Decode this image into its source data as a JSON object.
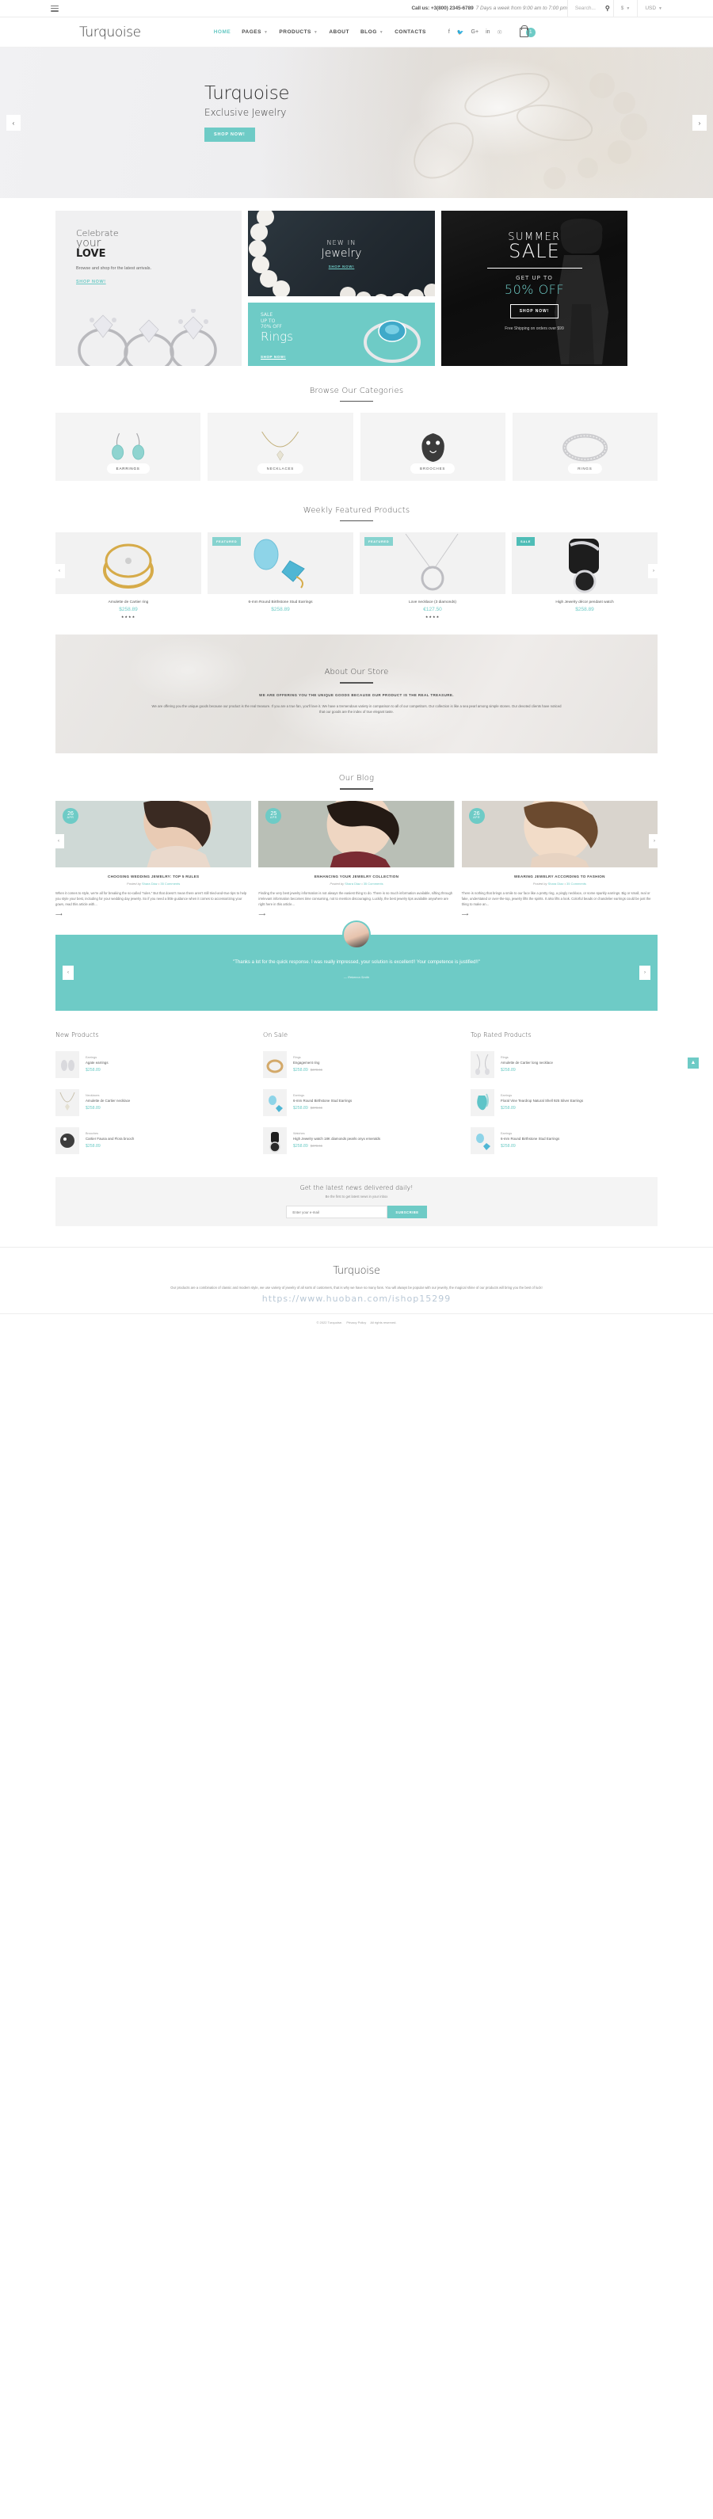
{
  "topbar": {
    "menu_icon": "hamburger-icon",
    "call_label": "Call us: +3(800) 2345-6789",
    "hours": "7 Days a week from 9:00 am to 7:00 pm",
    "search_placeholder": "Search...",
    "search_icon": "search-icon",
    "currency_symbol": "$",
    "currency_code": "USD"
  },
  "nav": {
    "logo": "Turquoise",
    "items": [
      {
        "label": "HOME",
        "active": true,
        "caret": false
      },
      {
        "label": "PAGES",
        "active": false,
        "caret": true
      },
      {
        "label": "PRODUCTS",
        "active": false,
        "caret": true
      },
      {
        "label": "ABOUT",
        "active": false,
        "caret": false
      },
      {
        "label": "BLOG",
        "active": false,
        "caret": true
      },
      {
        "label": "CONTACTS",
        "active": false,
        "caret": false
      }
    ],
    "socials": [
      "facebook-icon",
      "twitter-icon",
      "google-plus-icon",
      "linkedin-icon",
      "pinterest-icon"
    ],
    "cart_count": "1",
    "cart_icon": "shopping-bag-icon"
  },
  "hero": {
    "title": "Turquoise",
    "subtitle": "Exclusive Jewelry",
    "button": "SHOP NOW!",
    "prev_icon": "chevron-left-icon",
    "next_icon": "chevron-right-icon"
  },
  "promos": {
    "love": {
      "line1": "Celebrate",
      "line2": "your",
      "line3": "LOVE",
      "sub": "Browse and shop for the latest arrivals.",
      "link": "SHOP NOW!"
    },
    "new_in": {
      "line1": "NEW IN",
      "line2": "Jewelry",
      "link": "SHOP NOW!"
    },
    "rings": {
      "small": "SALE\nUP TO\n70% OFF",
      "small_l1": "SALE",
      "small_l2": "UP TO",
      "small_l3": "70% OFF",
      "big": "Rings",
      "link": "SHOP NOW!"
    },
    "summer": {
      "line1": "SUMMER",
      "line2": "SALE",
      "get": "GET UP TO",
      "off": "50% OFF",
      "button": "SHOP NOW!",
      "shipping": "Free Shipping on orders over $99"
    }
  },
  "categories": {
    "title": "Browse Our Categories",
    "items": [
      {
        "label": "EARRINGS",
        "active": true
      },
      {
        "label": "NECKLACES",
        "active": false
      },
      {
        "label": "BROOCHES",
        "active": false
      },
      {
        "label": "RINGS",
        "active": false
      }
    ]
  },
  "featured": {
    "title": "Weekly Featured Products",
    "prev_icon": "chevron-left-icon",
    "next_icon": "chevron-right-icon",
    "items": [
      {
        "name": "Amulette de Cartier ring",
        "price": "$258.89",
        "tag": "",
        "stars": "★★★★"
      },
      {
        "name": "6-mm Round Birthstone Stud Earrings",
        "price": "$258.89",
        "tag": "FEATURED",
        "stars": ""
      },
      {
        "name": "Love necklace (3 diamonds)",
        "price": "€127.50",
        "tag": "FEATURED",
        "stars": "★★★★"
      },
      {
        "name": "High Jewelry décor pendant watch",
        "price": "$258.89",
        "tag": "SALE",
        "stars": ""
      }
    ]
  },
  "about": {
    "title": "About Our Store",
    "lead": "WE ARE OFFERING YOU THE UNIQUE GOODS BECAUSE OUR PRODUCT IS THE REAL TREASURE.",
    "body": "We are offering you the unique goods because our product is the real treasure. If you are a true fan, you'll love it. We have a tremendous variety in comparison to all of our competitors. Our collection is like a sea pearl among simple stones. Our devoted clients have noticed that our goods are the index of true elegant taste."
  },
  "blog": {
    "title": "Our Blog",
    "prev_icon": "chevron-left-icon",
    "next_icon": "chevron-right-icon",
    "posts": [
      {
        "day": "26",
        "month": "APR",
        "title": "CHOOSING WEDDING JEWELRY: TOP 5 RULES",
        "meta_by": "Posted by",
        "meta_author": "Shara Diaz",
        "meta_comments": "35 Comments",
        "excerpt": "When it comes to style, we're all for breaking the so-called \"rules.\" But that doesn't mean there aren't still tried-and-true tips to help you style your best, including for your wedding day jewelry. So if you need a little guidance when it comes to accessorizing your gown, read this article with...",
        "more_icon": "arrow-right-icon"
      },
      {
        "day": "25",
        "month": "APR",
        "title": "ENHANCING YOUR JEWELRY COLLECTION",
        "meta_by": "Posted by",
        "meta_author": "Shara Diaz",
        "meta_comments": "35 Comments",
        "excerpt": "Finding the very best jewelry information is not always the easiest thing to do. There is so much information available, sifting through irrelevant information becomes time consuming, not to mention discouraging. Luckily, the best jewelry tips available anywhere are right here in this article...",
        "more_icon": "arrow-right-icon"
      },
      {
        "day": "26",
        "month": "APR",
        "title": "WEARING JEWELRY ACCORDING TO FASHION",
        "meta_by": "Posted by",
        "meta_author": "Shara Diaz",
        "meta_comments": "35 Comments",
        "excerpt": "There is nothing that brings a smile to our face like a pretty ring, a pingly necklace, or some sparkly earrings. Big or small, real or fake, understated or over-the-top, jewelry lifts the spirits. It also lifts a look. Colorful beads or chandelier earrings could be just the thing to make an...",
        "more_icon": "arrow-right-icon"
      }
    ]
  },
  "testimonial": {
    "quote": "\"Thanks a lot for the quick response. I was really impressed, your solution is excellent!! Your competence is justified!!\"",
    "author": "— Rebecca Smith",
    "prev_icon": "chevron-left-icon",
    "next_icon": "chevron-right-icon",
    "avatar": "avatar-image"
  },
  "product_lists": [
    {
      "heading": "New Products",
      "items": [
        {
          "cat": "Earrings",
          "name": "Agate earrings",
          "price": "$258.89",
          "old": ""
        },
        {
          "cat": "Necklaces",
          "name": "Amulette de Cartier necklace",
          "price": "$258.89",
          "old": ""
        },
        {
          "cat": "Brooches",
          "name": "Cartier Fauna and Flora brooch",
          "price": "$258.89",
          "old": ""
        }
      ]
    },
    {
      "heading": "On Sale",
      "items": [
        {
          "cat": "Rings",
          "name": "Engagement ring",
          "price": "$258.89",
          "old": "$378.66"
        },
        {
          "cat": "Earrings",
          "name": "6-mm Round Birthstone Stud Earrings",
          "price": "$258.89",
          "old": "$378.66"
        },
        {
          "cat": "Watches",
          "name": "High Jewelry watch 18K diamonds pearls onyx emeralds",
          "price": "$258.89",
          "old": "$378.66"
        }
      ]
    },
    {
      "heading": "Top Rated Products",
      "items": [
        {
          "cat": "Rings",
          "name": "Amulette de Cartier long necklace",
          "price": "$258.89",
          "old": ""
        },
        {
          "cat": "Earrings",
          "name": "Floral Vine Teardrop Natural Shell 925 Silver Earrings",
          "price": "$258.89",
          "old": ""
        },
        {
          "cat": "Earrings",
          "name": "6-mm Round Birthstone Stud Earrings",
          "price": "$258.89",
          "old": ""
        }
      ]
    }
  ],
  "newsletter": {
    "title": "Get the latest news delivered daily!",
    "subtitle": "Be the first to get latest news in your inbox",
    "placeholder": "Enter your e-mail",
    "button": "SUBSCRIBE"
  },
  "footer": {
    "logo": "Turquoise",
    "text": "Our products are a combination of classic and modern style, we use variety of jewelry of all sorts of customers, that is why we have so many fans. You will always be popular with our jewelry, the magical shine of our products will bring you the best of luck!",
    "watermark": "https://www.huoban.com/ishop15299",
    "copyright": "© 2022 Turquoise.",
    "links": [
      "Privacy Policy",
      "All rights reserved."
    ],
    "scroll_top_icon": "arrow-up-icon"
  },
  "colors": {
    "accent": "#6ecbc6",
    "dark": "#2e2e2e",
    "muted": "#8a8a8a"
  }
}
